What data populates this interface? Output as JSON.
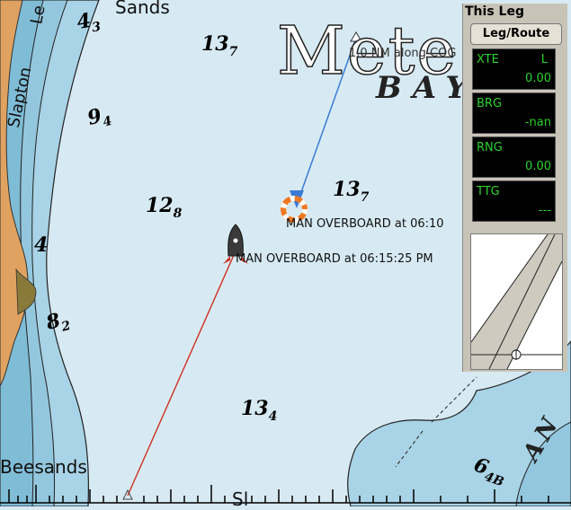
{
  "map": {
    "soundings": [
      {
        "main": "13",
        "sub": "7"
      },
      {
        "main": "13",
        "sub": "7"
      },
      {
        "main": "12",
        "sub": "8"
      },
      {
        "main": "13",
        "sub": "4"
      },
      {
        "main": "9",
        "sub": "4"
      },
      {
        "main": "8",
        "sub": "2"
      },
      {
        "main": "4",
        "sub": ""
      },
      {
        "main": "4",
        "sub": "3"
      },
      {
        "main": "6",
        "sub": "4B"
      }
    ],
    "place_names": {
      "slapton": "Slapton",
      "sands": "Sands",
      "beesands": "Beesands",
      "le": "Le",
      "sl": "Sl"
    },
    "watermark": "Mete",
    "bay": "BAY",
    "an": "AN",
    "route_label": "1.0 NM along COG",
    "mob_label_1": "MAN OVERBOARD at 06:10",
    "mob_label_2": "MAN OVERBOARD at 06:15:25 PM"
  },
  "panel": {
    "title": "This Leg",
    "leg_route_button": "Leg/Route",
    "instruments": [
      {
        "label": "XTE",
        "unit": "L",
        "value": "0.00"
      },
      {
        "label": "BRG",
        "unit": "",
        "value": "-nan"
      },
      {
        "label": "RNG",
        "unit": "",
        "value": "0.00"
      },
      {
        "label": "TTG",
        "unit": "",
        "value": "---"
      }
    ]
  },
  "colors": {
    "water": "#d7eaf3",
    "shallow": "#a9d3e6",
    "land": "#e0a260",
    "instrument_green": "#2bd22b",
    "route_blue": "#3a7bd5",
    "track_red": "#d03020"
  }
}
